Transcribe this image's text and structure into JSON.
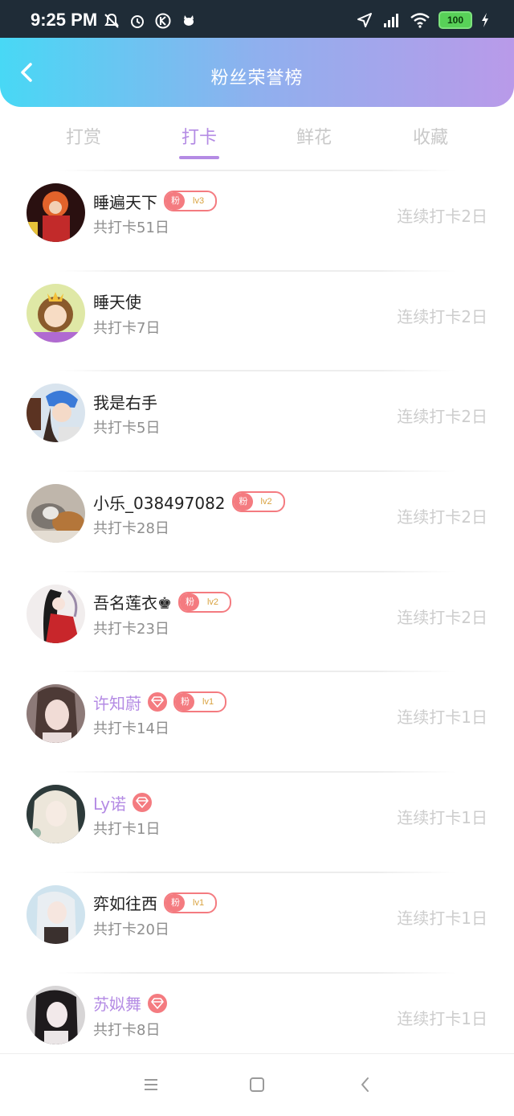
{
  "status_bar": {
    "time": "9:25 PM",
    "battery": "100"
  },
  "header": {
    "title": "粉丝荣誉榜"
  },
  "tabs": [
    {
      "label": "打赏",
      "active": false
    },
    {
      "label": "打卡",
      "active": true
    },
    {
      "label": "鲜花",
      "active": false
    },
    {
      "label": "收藏",
      "active": false
    }
  ],
  "colors": {
    "accent": "#b48be4",
    "badge": "#f47b80"
  },
  "list": [
    {
      "name": "睡遍天下",
      "vip": false,
      "fan_badge": {
        "label": "粉",
        "level": "lv3"
      },
      "total": "共打卡51日",
      "streak": "连续打卡2日"
    },
    {
      "name": "睡天使",
      "vip": false,
      "fan_badge": null,
      "total": "共打卡7日",
      "streak": "连续打卡2日"
    },
    {
      "name": "我是右手",
      "vip": false,
      "fan_badge": null,
      "total": "共打卡5日",
      "streak": "连续打卡2日"
    },
    {
      "name": "小乐_038497082",
      "vip": false,
      "fan_badge": {
        "label": "粉",
        "level": "lv2"
      },
      "total": "共打卡28日",
      "streak": "连续打卡2日"
    },
    {
      "name": "吾名莲衣♚",
      "vip": false,
      "fan_badge": {
        "label": "粉",
        "level": "lv2"
      },
      "total": "共打卡23日",
      "streak": "连续打卡2日"
    },
    {
      "name": "许知蔚",
      "vip": true,
      "fan_badge": {
        "label": "粉",
        "level": "lv1"
      },
      "total": "共打卡14日",
      "streak": "连续打卡1日"
    },
    {
      "name": "Ly诺",
      "vip": true,
      "fan_badge": null,
      "total": "共打卡1日",
      "streak": "连续打卡1日"
    },
    {
      "name": "弈如往西",
      "vip": false,
      "fan_badge": {
        "label": "粉",
        "level": "lv1"
      },
      "total": "共打卡20日",
      "streak": "连续打卡1日"
    },
    {
      "name": "苏姒舞",
      "vip": true,
      "fan_badge": null,
      "total": "共打卡8日",
      "streak": "连续打卡1日"
    }
  ]
}
